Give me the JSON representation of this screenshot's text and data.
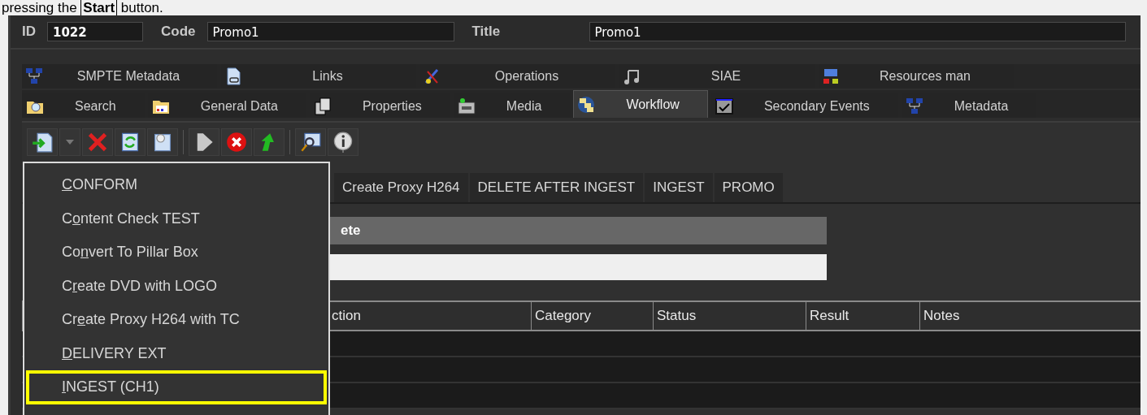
{
  "caption": "pressing the **Start** button.",
  "header": {
    "id_label": "ID",
    "id_value": "1022",
    "code_label": "Code",
    "code_value": "Promo1",
    "title_label": "Title",
    "title_value": "Promo1"
  },
  "tabs_row_1": [
    {
      "label": "SMPTE Metadata",
      "selected": false
    },
    {
      "label": "Links",
      "selected": false
    },
    {
      "label": "Operations",
      "selected": false
    },
    {
      "label": "SIAE",
      "selected": false
    },
    {
      "label": "Resources man",
      "selected": false
    }
  ],
  "tabs_row_2": [
    {
      "label": "Search",
      "selected": false
    },
    {
      "label": "General Data",
      "selected": false
    },
    {
      "label": "Properties",
      "selected": false
    },
    {
      "label": "Media",
      "selected": false
    },
    {
      "label": "Workflow",
      "selected": true
    },
    {
      "label": "Secondary Events",
      "selected": false
    },
    {
      "label": "Metadata",
      "selected": false
    }
  ],
  "workflow_tabs": [
    "Create Proxy H264",
    "DELETE AFTER INGEST",
    "INGEST",
    "PROMO"
  ],
  "bar_text": "ete",
  "table": {
    "columns": [
      "ction",
      "Category",
      "Status",
      "Result",
      "Notes"
    ]
  },
  "menu": [
    {
      "key": "C",
      "after": "ONFORM",
      "selected": false
    },
    {
      "before": "C",
      "key": "o",
      "after": "ntent Check TEST",
      "selected": false
    },
    {
      "before": "Co",
      "key": "n",
      "after": "vert To Pillar Box",
      "selected": false
    },
    {
      "before": "C",
      "key": "r",
      "after": "eate DVD with LOGO",
      "selected": false
    },
    {
      "before": "Cr",
      "key": "e",
      "after": "ate Proxy H264 with TC",
      "selected": false
    },
    {
      "key": "D",
      "after": "ELIVERY EXT",
      "selected": false
    },
    {
      "key": "I",
      "after": "NGEST (CH1)",
      "selected": true
    }
  ]
}
